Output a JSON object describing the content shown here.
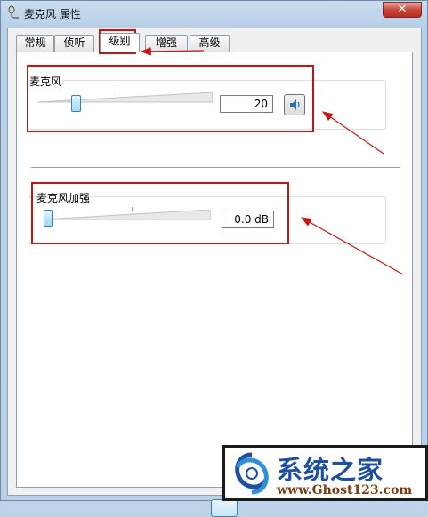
{
  "window": {
    "title": "麦克风 属性",
    "close_symbol": "✕",
    "icon": "microphone-icon"
  },
  "tabs": [
    {
      "label": "常规",
      "active": false
    },
    {
      "label": "侦听",
      "active": false
    },
    {
      "label": "级别",
      "active": true
    },
    {
      "label": "增强",
      "active": false
    },
    {
      "label": "高级",
      "active": false
    }
  ],
  "mic": {
    "label": "麦克风",
    "value": "20",
    "level": 0.2,
    "mute_icon": "speaker-icon"
  },
  "boost": {
    "label": "麦克风加强",
    "value": "0.0 dB",
    "level": 0
  },
  "watermark": {
    "main": "系统之家",
    "url": "www.Ghost123.com",
    "logo": "swirl-logo-icon"
  },
  "colors": {
    "annotation_red": "#cc1111",
    "thumb_blue": "#3c7fb1"
  }
}
